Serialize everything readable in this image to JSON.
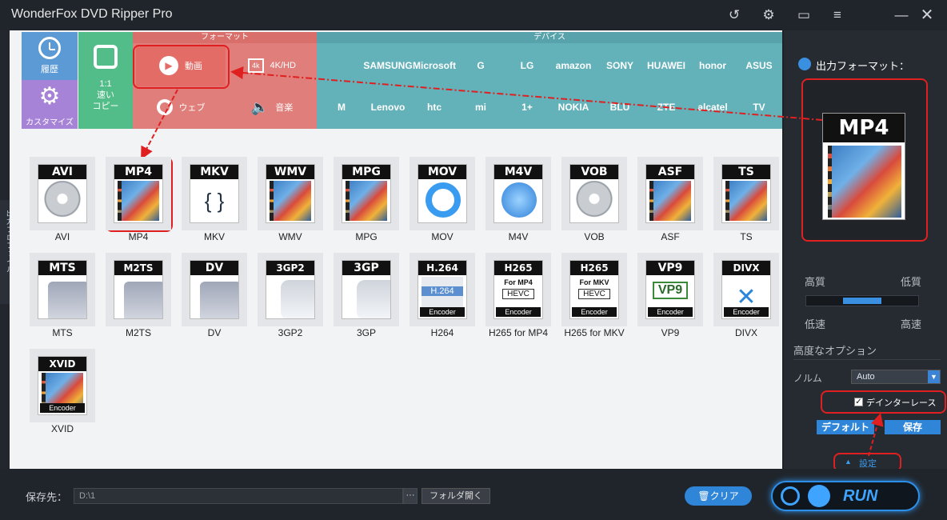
{
  "app_title": "WonderFox DVD Ripper Pro",
  "categories": {
    "format_header": "フォーマット",
    "device_header": "デバイス",
    "history": "履歴",
    "customize": "カスタマイズ",
    "copy": "1:1\n速い\nコピー",
    "video": "動画",
    "hd": "4K/HD",
    "web": "ウェブ",
    "music": "音楽"
  },
  "brands_row1": [
    "",
    "SAMSUNG",
    "Microsoft",
    "G",
    "LG",
    "amazon",
    "SONY",
    "HUAWEI",
    "honor",
    "ASUS"
  ],
  "brands_row2": [
    "M",
    "Lenovo",
    "htc",
    "mi",
    "1+",
    "NOKIA",
    "BLU",
    "ZTE",
    "alcatel",
    "TV"
  ],
  "formats": [
    {
      "label": "AVI",
      "icon": "AVI",
      "art": "disc"
    },
    {
      "label": "MP4",
      "icon": "MP4",
      "art": "film"
    },
    {
      "label": "MKV",
      "icon": "MKV",
      "art": "matroska"
    },
    {
      "label": "WMV",
      "icon": "WMV",
      "art": "film"
    },
    {
      "label": "MPG",
      "icon": "MPG",
      "art": "film"
    },
    {
      "label": "MOV",
      "icon": "MOV",
      "art": "quicktime"
    },
    {
      "label": "M4V",
      "icon": "M4V",
      "art": "itunes"
    },
    {
      "label": "VOB",
      "icon": "VOB",
      "art": "disc"
    },
    {
      "label": "ASF",
      "icon": "ASF",
      "art": "film"
    },
    {
      "label": "TS",
      "icon": "TS",
      "art": "film"
    },
    {
      "label": "MTS",
      "icon": "MTS",
      "art": "cam"
    },
    {
      "label": "M2TS",
      "icon": "M2TS",
      "art": "cam"
    },
    {
      "label": "DV",
      "icon": "DV",
      "art": "cam"
    },
    {
      "label": "3GP2",
      "icon": "3GP2",
      "art": "phone"
    },
    {
      "label": "3GP",
      "icon": "3GP",
      "art": "phone"
    },
    {
      "label": "H264",
      "icon": "H.264",
      "art": "h264"
    },
    {
      "label": "H265 for MP4",
      "icon": "H265",
      "art": "hevc-mp4"
    },
    {
      "label": "H265 for MKV",
      "icon": "H265",
      "art": "hevc-mkv"
    },
    {
      "label": "VP9",
      "icon": "VP9",
      "art": "vp9"
    },
    {
      "label": "DIVX",
      "icon": "DIVX",
      "art": "divx"
    },
    {
      "label": "XVID",
      "icon": "XVID",
      "art": "xvid"
    }
  ],
  "encoder_label": "Encoder",
  "hevc_text": "HEVC",
  "for_mp4": "For MP4",
  "for_mkv": "For MKV",
  "h264_badge": "H.264",
  "vp9_badge": "VP9",
  "right": {
    "output_format_label": "出力フォーマット：",
    "selected_format": "MP4",
    "high_quality": "高質",
    "low_quality": "低質",
    "low_speed": "低速",
    "high_speed": "高速",
    "quality_level": 0.5,
    "advanced_options": "高度なオプション",
    "norm_label": "ノルム",
    "norm_value": "Auto",
    "deinterlace": "デインターレース",
    "deinterlace_checked": true,
    "default_btn": "デフォルト",
    "save_btn": "保存",
    "settings": "設定"
  },
  "side_tab": "出力プロファイル",
  "bottom": {
    "save_to": "保存先：",
    "path": "D:\\1",
    "dots": "···",
    "open_folder": "フォルダ開く",
    "clear": "クリア",
    "run": "RUN"
  }
}
